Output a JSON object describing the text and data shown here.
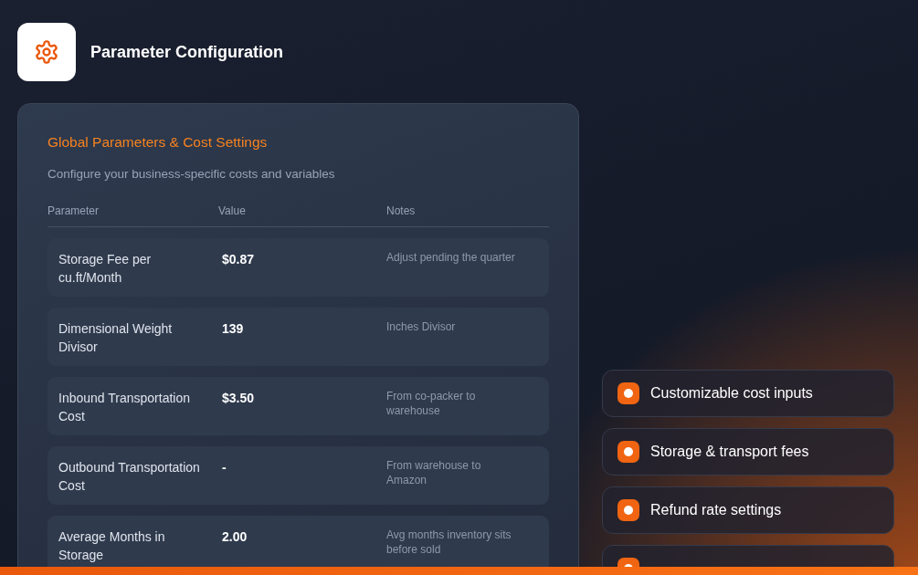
{
  "header": {
    "title": "Parameter Configuration"
  },
  "card": {
    "title": "Global Parameters & Cost Settings",
    "subtitle": "Configure your business-specific costs and variables",
    "columns": [
      "Parameter",
      "Value",
      "Notes"
    ],
    "rows": [
      {
        "parameter": "Storage Fee per cu.ft/Month",
        "value": "$0.87",
        "notes": "Adjust pending the quarter"
      },
      {
        "parameter": "Dimensional Weight Divisor",
        "value": "139",
        "notes": "Inches Divisor"
      },
      {
        "parameter": "Inbound Transportation Cost",
        "value": "$3.50",
        "notes": "From co-packer to warehouse"
      },
      {
        "parameter": "Outbound Transportation Cost",
        "value": "-",
        "notes": "From warehouse to Amazon"
      },
      {
        "parameter": "Average Months in Storage",
        "value": "2.00",
        "notes": "Avg months inventory sits before sold"
      }
    ]
  },
  "features": [
    "Customizable cost inputs",
    "Storage & transport fees",
    "Refund rate settings"
  ],
  "more_features_below": true
}
